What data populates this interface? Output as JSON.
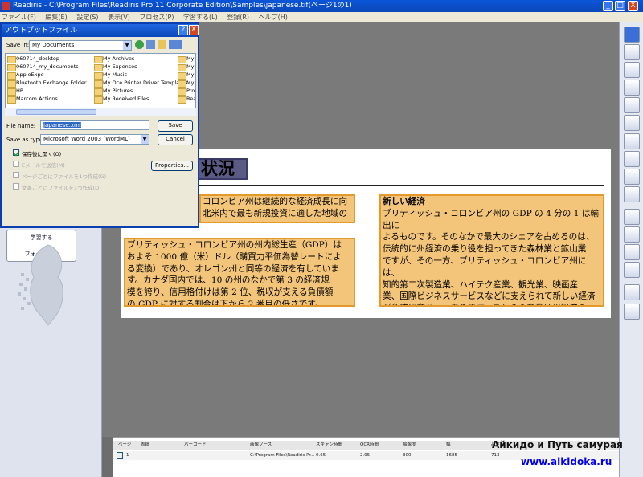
{
  "window": {
    "title": "Readiris - C:\\Program Files\\Readiris Pro 11 Corporate Edition\\Samples\\japanese.tif(ページ1の1)",
    "min": "_",
    "max": "□",
    "close": "X"
  },
  "menu": [
    "ファイル(F)",
    "編集(E)",
    "設定(S)",
    "表示(V)",
    "プロセス(P)",
    "学習する(L)",
    "登録(R)",
    "ヘルプ(H)"
  ],
  "left_panel": {
    "learn_label": "学習する",
    "format_label": "フォーマット"
  },
  "dialog": {
    "title": "アウトプットファイル",
    "help": "?",
    "close": "X",
    "save_in_label": "Save in:",
    "save_in_value": "My Documents",
    "files_col1": [
      "060714_desktop",
      "060714_my_documents",
      "AppleExpo",
      "Bluetooth Exchange Folder",
      "HP",
      "Marcom Actions"
    ],
    "files_col2": [
      "My Archives",
      "My Expenses",
      "My Music",
      "My Oce Printer Driver Templates",
      "My Pictures",
      "My Received Files"
    ],
    "files_col3": [
      "My S",
      "My S",
      "My S",
      "My V",
      "Proc",
      "Rea"
    ],
    "file_name_label": "File name:",
    "file_name_value": "japanese.xml",
    "save_as_label": "Save as type:",
    "save_as_value": "Microsoft Word 2003 (WordML)",
    "save_button": "Save",
    "cancel_button": "Cancel",
    "properties_button": "Properties...",
    "open_after_saving": "保存後に開く(O)",
    "email": "Eメールで送信(M)",
    "file_per_page": "ページごとにファイルを1つ作成(G)",
    "file_per_doc": "文書ごとにファイルを1つ作成(D)"
  },
  "document": {
    "heading": "状況",
    "zone_left_top": "コロンビア州は継続的な経済成長に向\n北米内で最も新規投資に適した地域の",
    "zone_left_bottom": "ブリティッシュ・コロンビア州の州内総生産（GDP）は\nおよそ 1000 億（米）ドル（購買力平価為替レートによ\nる変換）であり、オレゴン州と同等の経済を有していま\nす。カナダ国内では、10 の州のなかで第 3 の経済規\n模を誇り、信用格付けは第 2 位、税収が支える負債額\nの GDP に対する割合は下から 2 番目の低さです。",
    "zone_right_title": "新しい経済",
    "zone_right": "ブリティッシュ・コロンビア州の GDP の 4 分の 1 は輸出に\nよるものです。そのなかで最大のシェアを占めるのは、\n伝統的に州経済の乗り役を担ってきた森林業と鉱山業\nですが、その一方、ブリティッシュ・コロンビア州には、\n知的第二次製造業、ハイテク産業、観光業、映画産\n業、国際ビジネスサービスなどに支えられて新しい経済\nが急速に育ちつつあります。これらの産業は州経済の\n多様性を増し、輸出関連の雇用増加に大きく貢献して\nいます。"
  },
  "table": {
    "headers": [
      "ページ",
      "表紙",
      "バーコード",
      "画像ソース",
      "スキャン時間",
      "OCR時間",
      "解像度",
      "幅",
      "高さ"
    ],
    "row": [
      "1",
      "-",
      "",
      "C:\\Program Files\\Readiris Pr...",
      "0.65",
      "2.95",
      "300",
      "1685",
      "713"
    ]
  },
  "watermark": {
    "line1": "Айкидо и Путь самурая",
    "line2": "www.aikidoka.ru"
  }
}
